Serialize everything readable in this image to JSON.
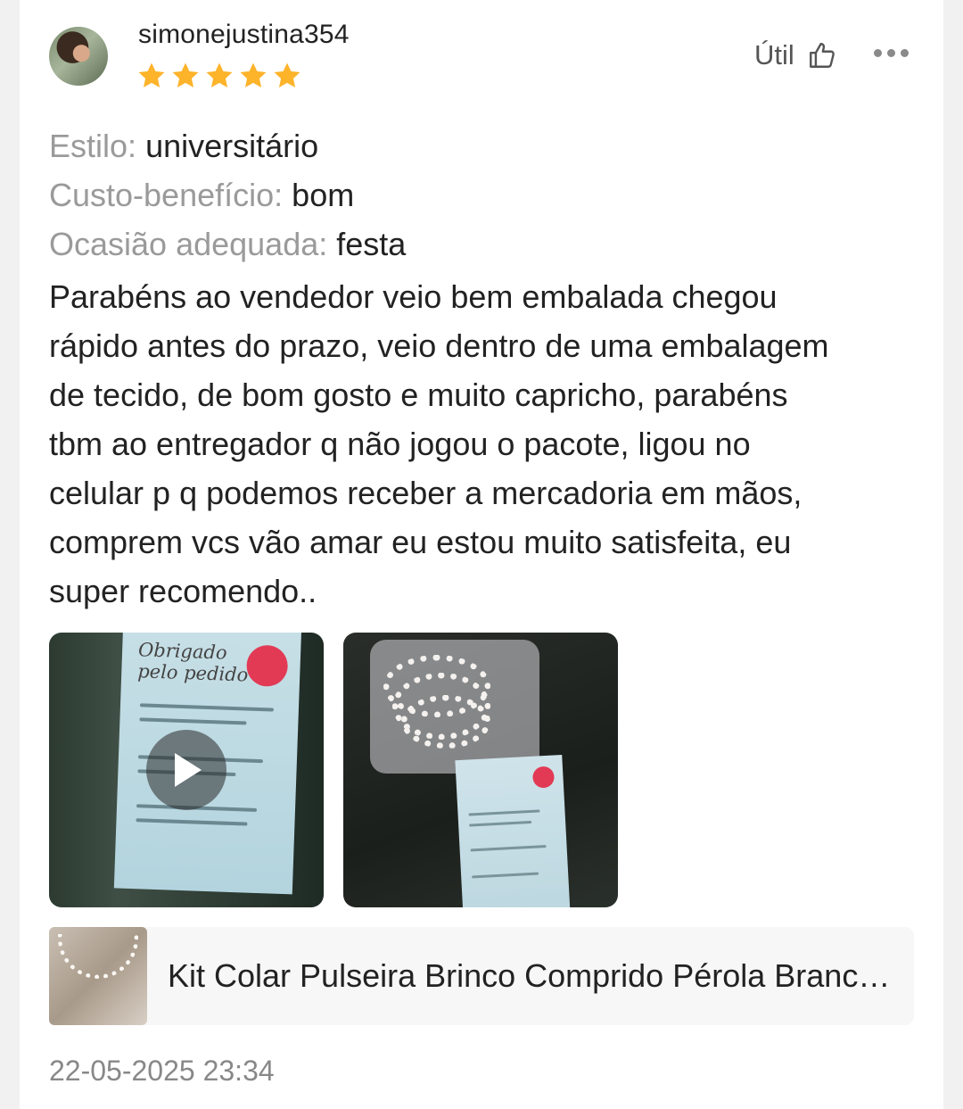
{
  "review": {
    "username": "simonejustina354",
    "rating": 5,
    "rating_max": 5,
    "star_color": "#FDB32A",
    "helpful_label": "Útil",
    "helpful_icon": "thumbs-up-icon",
    "more_icon": "more-options-icon",
    "attributes": [
      {
        "label": "Estilo:",
        "value": "universitário"
      },
      {
        "label": "Custo-benefício:",
        "value": "bom"
      },
      {
        "label": "Ocasião adequada:",
        "value": "festa"
      }
    ],
    "text": "Parabéns ao vendedor veio bem embalada chegou\nrápido antes do prazo,  veio dentro de uma embalagem\nde tecido,  de bom gosto e muito capricho, parabéns\ntbm ao entregador q não jogou o pacote,  ligou no\ncelular p q podemos receber a mercadoria em mãos,\ncomprem vcs vão amar  eu estou muito satisfeita, eu\nsuper recomendo..",
    "media": [
      {
        "type": "video",
        "icon": "play-icon"
      },
      {
        "type": "image"
      }
    ],
    "product": {
      "title": "Kit Colar Pulseira Brinco Comprido Pérola Branca com Strass"
    },
    "date": "22-05-2025 23:34"
  }
}
